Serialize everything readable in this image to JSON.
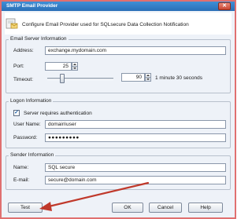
{
  "window": {
    "title": "SMTP Email Provider",
    "close_glyph": "✕"
  },
  "header": {
    "description": "Configure Email Provider used for SQLsecure Data Collection Notification",
    "icon": "email-provider-icon"
  },
  "server": {
    "legend": "Email Server Information",
    "address_label": "Address:",
    "address_value": "exchange.mydomain.com",
    "port_label": "Port:",
    "port_value": "25",
    "timeout_label": "Timeout:",
    "timeout_value": "90",
    "timeout_text": "1 minute 30 seconds",
    "timeout_slider_fraction": 0.2
  },
  "logon": {
    "legend": "Logon Information",
    "auth_label": "Server requires authentication",
    "auth_checked": true,
    "user_label": "User Name:",
    "user_value": "domain\\user",
    "password_label": "Password:",
    "password_value": "●●●●●●●●●"
  },
  "sender": {
    "legend": "Sender Information",
    "name_label": "Name:",
    "name_value": "SQL secure",
    "email_label": "E-mail:",
    "email_value": "secure@domain.com"
  },
  "buttons": {
    "test": "Test",
    "ok": "OK",
    "cancel": "Cancel",
    "help": "Help"
  },
  "annotation": {
    "arrow_color": "#c0392b"
  }
}
